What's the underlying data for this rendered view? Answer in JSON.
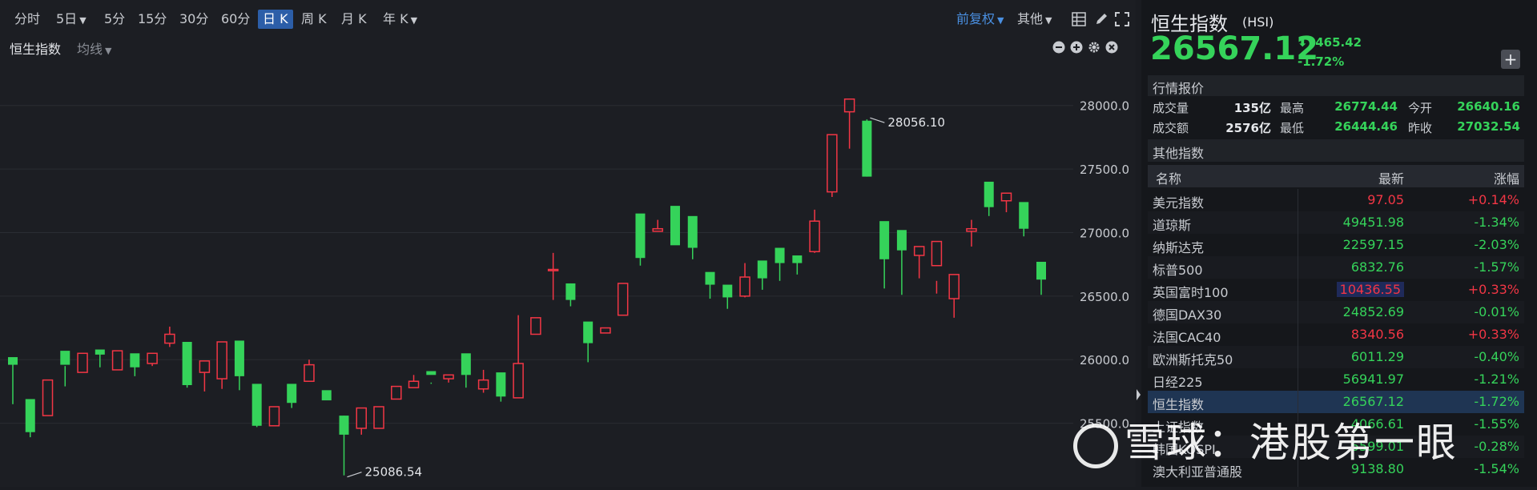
{
  "toolbar": {
    "periods": [
      "分时",
      "5日",
      "5分",
      "15分",
      "30分",
      "60分",
      "日 K",
      "周 K",
      "月 K",
      "年 K"
    ],
    "fuquan": "前复权",
    "other": "其他"
  },
  "subbar": {
    "name": "恒生指数",
    "ma": "均线"
  },
  "chart_data": {
    "type": "candlestick",
    "ylim": [
      25000,
      28250
    ],
    "yticks": [
      "28000.0",
      "27500.0",
      "27000.0",
      "26500.0",
      "26000.0",
      "25500.0"
    ],
    "annotations": [
      {
        "label": "28056.10"
      },
      {
        "label": "25086.54"
      }
    ],
    "up_color": "#f23645",
    "down_color": "#35d35a",
    "candles": [
      [
        25980,
        26020,
        25960,
        25650,
        0
      ],
      [
        25660,
        25690,
        25430,
        25390,
        0
      ],
      [
        25590,
        25840,
        25560,
        25620,
        1
      ],
      [
        25950,
        26070,
        25960,
        25790,
        0
      ],
      [
        25980,
        26050,
        25900,
        25960,
        1
      ],
      [
        26050,
        26080,
        26040,
        25940,
        0
      ],
      [
        25990,
        26070,
        25920,
        25970,
        1
      ],
      [
        25980,
        26050,
        25940,
        25870,
        0
      ],
      [
        26050,
        26050,
        25970,
        25950,
        1
      ],
      [
        26100,
        26130,
        26200,
        26260,
        1
      ],
      [
        26000,
        26140,
        25800,
        25780,
        0
      ],
      [
        25970,
        25990,
        25900,
        25750,
        1
      ],
      [
        26110,
        26140,
        25850,
        25770,
        1
      ],
      [
        26060,
        26150,
        25870,
        25760,
        0
      ],
      [
        25800,
        25810,
        25480,
        25470,
        0
      ],
      [
        25550,
        25630,
        25480,
        25490,
        1
      ],
      [
        25800,
        25810,
        25660,
        25620,
        0
      ],
      [
        25860,
        25830,
        25960,
        26000,
        1
      ],
      [
        25720,
        25760,
        25680,
        25710,
        0
      ],
      [
        25560,
        25560,
        25410,
        25090,
        0
      ],
      [
        25410,
        25460,
        25620,
        25610,
        1
      ],
      [
        25480,
        25460,
        25630,
        25630,
        1
      ],
      [
        25710,
        25690,
        25790,
        25790,
        1
      ],
      [
        25800,
        25780,
        25830,
        25880,
        1
      ],
      [
        25810,
        25880,
        25910,
        25820,
        0
      ],
      [
        25820,
        25850,
        25880,
        25880,
        1
      ],
      [
        25940,
        26050,
        25880,
        25780,
        0
      ],
      [
        25740,
        25770,
        25840,
        25920,
        1
      ],
      [
        25870,
        25900,
        25710,
        25670,
        0
      ],
      [
        25800,
        25700,
        25970,
        26350,
        1
      ],
      [
        26330,
        26330,
        26200,
        26310,
        1
      ],
      [
        26470,
        26700,
        26710,
        26840,
        1
      ],
      [
        26600,
        26600,
        26470,
        26420,
        0
      ],
      [
        26290,
        26300,
        26130,
        25980,
        0
      ],
      [
        26230,
        26210,
        26250,
        26250,
        1
      ],
      [
        26350,
        26350,
        26600,
        26600,
        1
      ],
      [
        26900,
        27150,
        26800,
        26740,
        0
      ],
      [
        27010,
        27030,
        27010,
        27100,
        1
      ],
      [
        26960,
        27210,
        26900,
        26920,
        0
      ],
      [
        27050,
        27130,
        26880,
        26790,
        0
      ],
      [
        26620,
        26690,
        26590,
        26480,
        0
      ],
      [
        26550,
        26590,
        26490,
        26400,
        0
      ],
      [
        26490,
        26500,
        26650,
        26760,
        1
      ],
      [
        26750,
        26780,
        26640,
        26550,
        0
      ],
      [
        26860,
        26880,
        26760,
        26620,
        0
      ],
      [
        26800,
        26820,
        26760,
        26670,
        0
      ],
      [
        26840,
        26850,
        27090,
        27180,
        1
      ],
      [
        27600,
        27770,
        27320,
        27280,
        1
      ],
      [
        27660,
        27950,
        28050,
        28050,
        1
      ],
      [
        27890,
        27880,
        27440,
        27440,
        0
      ],
      [
        27060,
        27090,
        26790,
        26560,
        0
      ],
      [
        26940,
        27020,
        26860,
        26510,
        0
      ],
      [
        26850,
        26890,
        26820,
        26640,
        1
      ],
      [
        26620,
        26930,
        26740,
        26520,
        1
      ],
      [
        26580,
        26670,
        26480,
        26330,
        1
      ],
      [
        27100,
        27030,
        27010,
        26890,
        1
      ],
      [
        27210,
        27400,
        27200,
        27130,
        0
      ],
      [
        27290,
        27310,
        27250,
        27160,
        1
      ],
      [
        27230,
        27240,
        27030,
        26970,
        0
      ],
      [
        26680,
        26770,
        26630,
        26510,
        0
      ]
    ]
  },
  "header": {
    "name": "恒生指数",
    "code": "(HSI)",
    "price": "26567.12",
    "change": "-465.42",
    "pct": "-1.72%"
  },
  "quote": {
    "title": "行情报价",
    "rows": [
      [
        {
          "l": "成交量",
          "v": "135亿"
        },
        {
          "l": "最高",
          "v": "26774.44"
        },
        {
          "l": "今开",
          "v": "26640.16"
        }
      ],
      [
        {
          "l": "成交额",
          "v": "2576亿"
        },
        {
          "l": "最低",
          "v": "26444.46"
        },
        {
          "l": "昨收",
          "v": "27032.54"
        }
      ]
    ]
  },
  "other": {
    "title": "其他指数",
    "cols": [
      "名称",
      "最新",
      "涨幅"
    ],
    "rows": [
      {
        "name": "美元指数",
        "last": "97.05",
        "chg": "+0.14%",
        "up": true
      },
      {
        "name": "道琼斯",
        "last": "49451.98",
        "chg": "-1.34%",
        "up": false
      },
      {
        "name": "纳斯达克",
        "last": "22597.15",
        "chg": "-2.03%",
        "up": false
      },
      {
        "name": "标普500",
        "last": "6832.76",
        "chg": "-1.57%",
        "up": false
      },
      {
        "name": "英国富时100",
        "last": "10436.55",
        "chg": "+0.33%",
        "up": true
      },
      {
        "name": "德国DAX30",
        "last": "24852.69",
        "chg": "-0.01%",
        "up": false
      },
      {
        "name": "法国CAC40",
        "last": "8340.56",
        "chg": "+0.33%",
        "up": true
      },
      {
        "name": "欧洲斯托克50",
        "last": "6011.29",
        "chg": "-0.40%",
        "up": false
      },
      {
        "name": "日经225",
        "last": "56941.97",
        "chg": "-1.21%",
        "up": false
      },
      {
        "name": "恒生指数",
        "last": "26567.12",
        "chg": "-1.72%",
        "up": false
      },
      {
        "name": "上证指数",
        "last": "4066.61",
        "chg": "-1.55%",
        "up": false
      },
      {
        "name": "韩国KOSPI",
        "last": "5599.01",
        "chg": "-0.28%",
        "up": false
      },
      {
        "name": "澳大利亚普通股",
        "last": "9138.80",
        "chg": "-1.54%",
        "up": false
      }
    ]
  },
  "watermark": "雪球：港股第一眼"
}
